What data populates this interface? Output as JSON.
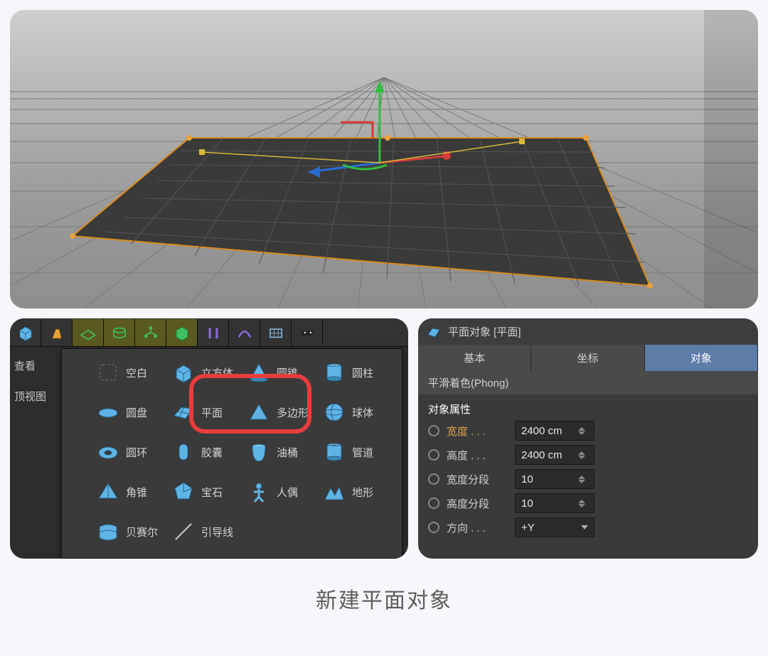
{
  "sidebar": {
    "view_label": "查看",
    "top_view_label": "顶视图"
  },
  "toolbar_icons": [
    "cube",
    "pen",
    "mesh",
    "tube",
    "tree",
    "box",
    "bracket",
    "arc",
    "grid",
    "eyes"
  ],
  "primitives": {
    "items": [
      {
        "name": "empty",
        "label": "空白"
      },
      {
        "name": "cube",
        "label": "立方体"
      },
      {
        "name": "cone",
        "label": "圆锥"
      },
      {
        "name": "cylinder",
        "label": "圆柱"
      },
      {
        "name": "disc",
        "label": "圆盘"
      },
      {
        "name": "plane",
        "label": "平面"
      },
      {
        "name": "polygon",
        "label": "多边形"
      },
      {
        "name": "sphere",
        "label": "球体"
      },
      {
        "name": "torus",
        "label": "圆环"
      },
      {
        "name": "capsule",
        "label": "胶囊"
      },
      {
        "name": "oiltank",
        "label": "油桶"
      },
      {
        "name": "tube",
        "label": "管道"
      },
      {
        "name": "pyramid",
        "label": "角锥"
      },
      {
        "name": "platonic",
        "label": "宝石"
      },
      {
        "name": "figure",
        "label": "人偶"
      },
      {
        "name": "landscape",
        "label": "地形"
      },
      {
        "name": "bezier",
        "label": "贝赛尔"
      },
      {
        "name": "guide",
        "label": "引导线"
      }
    ],
    "highlighted": "plane"
  },
  "properties": {
    "title": "平面对象 [平面]",
    "tabs": {
      "basic": "基本",
      "coords": "坐标",
      "object": "对象"
    },
    "active_tab": "object",
    "phong_label": "平滑着色(Phong)",
    "section_title": "对象属性",
    "rows": [
      {
        "key": "width",
        "label": "宽度 . . .",
        "value": "2400 cm",
        "accent": true,
        "type": "number"
      },
      {
        "key": "height",
        "label": "高度 . . .",
        "value": "2400 cm",
        "accent": false,
        "type": "number"
      },
      {
        "key": "seg_w",
        "label": "宽度分段",
        "value": "10",
        "accent": false,
        "type": "number"
      },
      {
        "key": "seg_h",
        "label": "高度分段",
        "value": "10",
        "accent": false,
        "type": "number"
      },
      {
        "key": "orient",
        "label": "方向 . . .",
        "value": "+Y",
        "accent": false,
        "type": "select"
      }
    ]
  },
  "caption": "新建平面对象",
  "colors": {
    "highlight": "#e83d3d",
    "tab_active": "#5d7ca8",
    "accent_text": "#d8a24a",
    "icon_blue": "#5fb4e6"
  }
}
